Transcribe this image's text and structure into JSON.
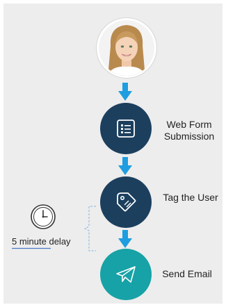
{
  "steps": [
    {
      "label_lines": [
        "Web Form",
        "Submission"
      ],
      "icon": "list-icon",
      "color": "#1c3f5e"
    },
    {
      "label_lines": [
        "Tag the User"
      ],
      "icon": "tag-icon",
      "color": "#1c3f5e"
    },
    {
      "label_lines": [
        "Send Email"
      ],
      "icon": "paper-plane-icon",
      "color": "#16a2a6"
    }
  ],
  "delay": {
    "label": "5 minute delay",
    "icon": "clock-icon"
  },
  "avatar": {
    "icon": "user-photo"
  },
  "colors": {
    "panel_background": "#ededed",
    "node_dark": "#1c3f5e",
    "node_teal": "#16a2a6",
    "arrow": "#1e9ee0",
    "bracket": "#7fb4e0",
    "text": "#222222"
  }
}
